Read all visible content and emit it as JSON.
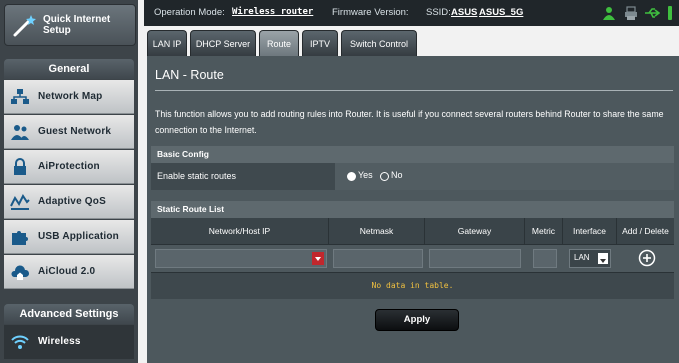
{
  "sidebar": {
    "quick_setup": {
      "line1": "Quick Internet",
      "line2": "Setup"
    },
    "general_header": "General",
    "general_items": [
      {
        "label": "Network Map",
        "icon": "network-map-icon"
      },
      {
        "label": "Guest Network",
        "icon": "guest-network-icon"
      },
      {
        "label": "AiProtection",
        "icon": "lock-icon"
      },
      {
        "label": "Adaptive QoS",
        "icon": "qos-icon"
      },
      {
        "label": "USB Application",
        "icon": "puzzle-icon"
      },
      {
        "label": "AiCloud 2.0",
        "icon": "cloud-house-icon"
      }
    ],
    "advanced_header": "Advanced Settings",
    "advanced_items": [
      {
        "label": "Wireless",
        "icon": "wireless-icon"
      }
    ]
  },
  "topbar": {
    "op_mode_label": "Operation Mode:",
    "op_mode_value": "Wireless router",
    "firmware_label": "Firmware Version:",
    "ssid_label": "SSID:",
    "ssid1": "ASUS",
    "ssid2": "ASUS_5G"
  },
  "tabs": [
    {
      "label": "LAN IP",
      "active": false
    },
    {
      "label": "DHCP Server",
      "active": false
    },
    {
      "label": "Route",
      "active": true
    },
    {
      "label": "IPTV",
      "active": false
    },
    {
      "label": "Switch Control",
      "active": false
    }
  ],
  "page": {
    "title": "LAN - Route",
    "description": "This function allows you to add routing rules into Router. It is useful if you connect several routers behind Router to share the same connection to the Internet."
  },
  "basic_config": {
    "header": "Basic Config",
    "enable_label": "Enable static routes",
    "option_yes": "Yes",
    "option_no": "No",
    "selected": "Yes"
  },
  "route_list": {
    "header": "Static Route List",
    "columns": [
      "Network/Host IP",
      "Netmask",
      "Gateway",
      "Metric",
      "Interface",
      "Add / Delete"
    ],
    "interface_value": "LAN",
    "empty_message": "No data in table."
  },
  "apply_label": "Apply",
  "colors": {
    "accent_green": "#3fbf3f",
    "warning_yellow": "#f0c040",
    "dropdown_red": "#c1272d"
  }
}
